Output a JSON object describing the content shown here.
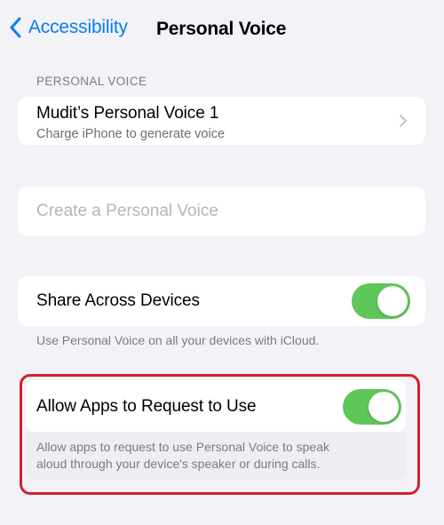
{
  "navbar": {
    "back_label": "Accessibility",
    "title": "Personal Voice"
  },
  "personal_voice_section": {
    "header": "PERSONAL VOICE",
    "voice_name": "Mudit’s Personal Voice 1",
    "voice_status": "Charge iPhone to generate voice",
    "create_label": "Create a Personal Voice"
  },
  "share_across_devices": {
    "label": "Share Across Devices",
    "enabled": true,
    "footer": "Use Personal Voice on all your devices with iCloud."
  },
  "allow_apps": {
    "label": "Allow Apps to Request to Use",
    "enabled": true,
    "footer_line1": "Allow apps to request to use Personal Voice to speak",
    "footer_line2": "aloud through your device's speaker or during calls."
  },
  "colors": {
    "accent": "#0a7aff",
    "toggle_on": "#5fc65a",
    "highlight": "#d61f2c",
    "background": "#f2f2f7"
  },
  "icons": {
    "back": "chevron-left-icon",
    "disclosure": "chevron-right-icon"
  }
}
